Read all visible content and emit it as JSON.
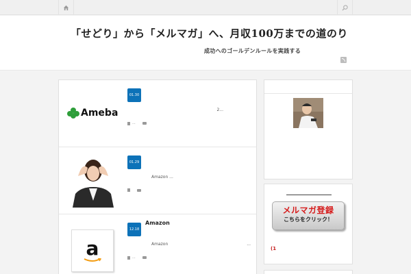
{
  "header": {
    "site_title": "「せどり」から「メルマガ」へ、月収100万までの道のり",
    "site_description": "成功へのゴールデンルールを実践する",
    "icons": [
      "home-icon",
      "search-icon",
      "rss-icon"
    ]
  },
  "posts": [
    {
      "date": "01.30",
      "title": "",
      "thumb_text": "Ameba",
      "excerpt": "2...",
      "comments_label": "..."
    },
    {
      "date": "01.29",
      "title": "",
      "thumb_text": "",
      "excerpt": "Amazon ...",
      "comments_label": ""
    },
    {
      "date": "12.18",
      "title": "Amazon",
      "thumb_text": "a",
      "excerpt": "Amazon",
      "excerpt_tail": "...",
      "comments_label": "..."
    }
  ],
  "sidebar": {
    "banner_line1": "メルマガ登録",
    "banner_line2": "こちらをクリック！",
    "note": "(1"
  },
  "colors": {
    "date_badge": "#0d72b8",
    "banner_red": "#d61b1b",
    "ameba_green": "#2e9e3a"
  }
}
